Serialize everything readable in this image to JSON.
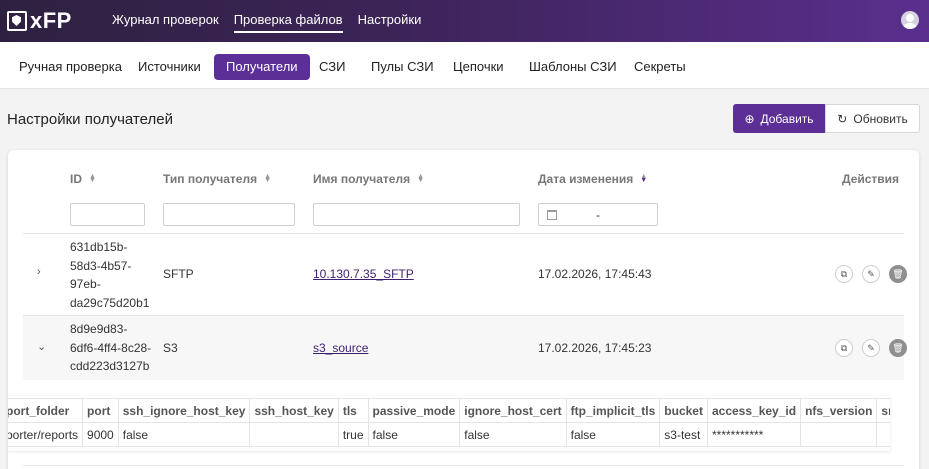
{
  "app": {
    "logo_text": "xFP"
  },
  "topnav": [
    {
      "label": "Журнал проверок",
      "active": false
    },
    {
      "label": "Проверка файлов",
      "active": true
    },
    {
      "label": "Настройки",
      "active": false
    }
  ],
  "subtabs": [
    {
      "label": "Ручная проверка"
    },
    {
      "label": "Источники"
    },
    {
      "label": "Получатели",
      "active": true
    },
    {
      "label": "СЗИ"
    },
    {
      "label": "Пулы СЗИ"
    },
    {
      "label": "Цепочки"
    },
    {
      "label": "Шаблоны СЗИ"
    },
    {
      "label": "Секреты"
    }
  ],
  "page": {
    "title": "Настройки получателей",
    "add_label": "Добавить",
    "refresh_label": "Обновить"
  },
  "table": {
    "headers": {
      "id": "ID",
      "type": "Тип получателя",
      "name": "Имя получателя",
      "date": "Дата изменения",
      "actions": "Действия"
    },
    "date_filter_separator": "-",
    "rows": [
      {
        "id": "631db15b-58d3-4b57-97eb-da29c75d20b1",
        "id_lines": [
          "631db15b-",
          "58d3-4b57-",
          "97eb-",
          "da29c75d20b1"
        ],
        "type": "SFTP",
        "name": "10.130.7.35_SFTP",
        "date": "17.02.2026, 17:45:43",
        "expanded": false
      },
      {
        "id": "8d9e9d83-6df6-4ff4-8c28-cdd223d3127b",
        "id_lines": [
          "8d9e9d83-",
          "6df6-4ff4-8c28-",
          "cdd223d3127b"
        ],
        "type": "S3",
        "name": "s3_source",
        "date": "17.02.2026, 17:45:23",
        "expanded": true
      }
    ]
  },
  "details": {
    "headers": [
      "port_folder",
      "port",
      "ssh_ignore_host_key",
      "ssh_host_key",
      "tls",
      "passive_mode",
      "ignore_host_cert",
      "ftp_implicit_tls",
      "bucket",
      "access_key_id",
      "nfs_version",
      "smb_version"
    ],
    "values": [
      "porter/reports",
      "9000",
      "false",
      "",
      "true",
      "false",
      "false",
      "false",
      "s3-test",
      "***********",
      "",
      ""
    ]
  },
  "colors": {
    "accent": "#5b2f96",
    "topbar_start": "#2e2140",
    "topbar_end": "#5a2f8e"
  }
}
